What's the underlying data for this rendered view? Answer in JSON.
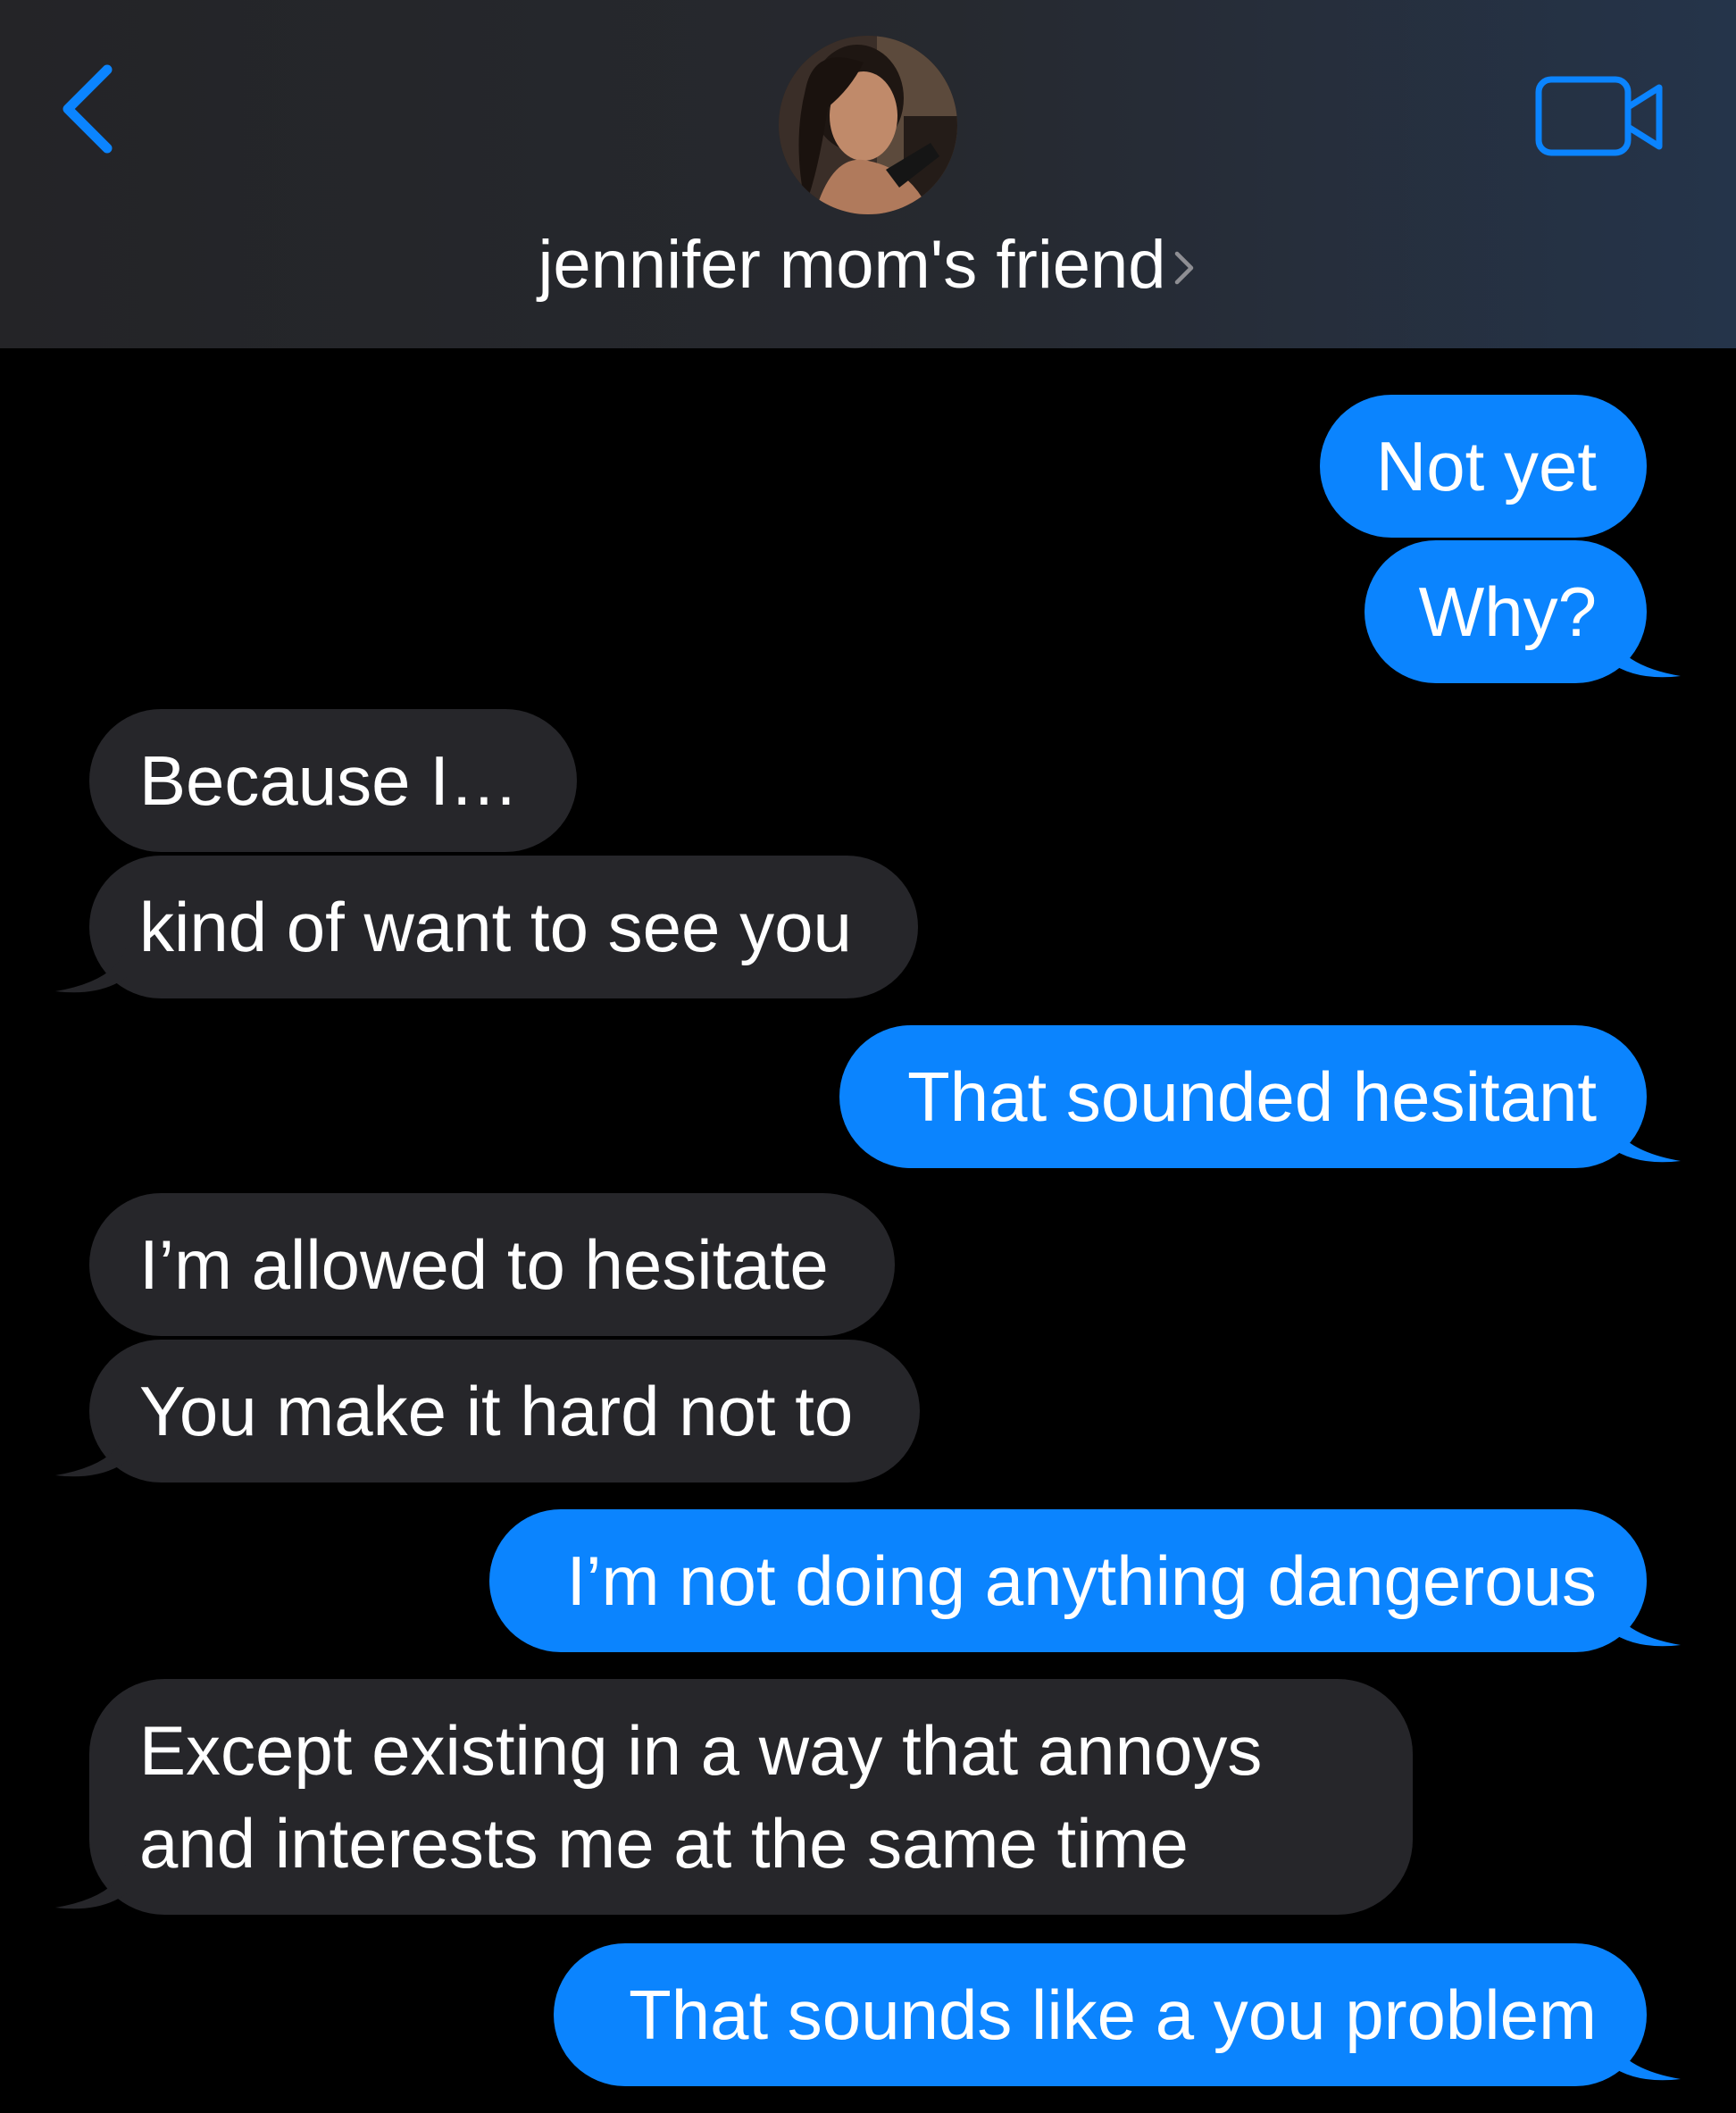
{
  "header": {
    "contact_name": "jennifer mom's friend",
    "back_icon": "chevron-left-icon",
    "video_icon": "video-camera-icon",
    "accent_color": "#0b84fe"
  },
  "messages": [
    {
      "id": "m1",
      "direction": "sent",
      "text": "Not yet",
      "tail": false
    },
    {
      "id": "m2",
      "direction": "sent",
      "text": "Why?",
      "tail": true
    },
    {
      "id": "m3",
      "direction": "received",
      "text": "Because I…",
      "tail": false
    },
    {
      "id": "m4",
      "direction": "received",
      "text": "kind of want to see you",
      "tail": true
    },
    {
      "id": "m5",
      "direction": "sent",
      "text": "That sounded hesitant",
      "tail": true
    },
    {
      "id": "m6",
      "direction": "received",
      "text": "I’m allowed to hesitate",
      "tail": false
    },
    {
      "id": "m7",
      "direction": "received",
      "text": "You make it hard not to",
      "tail": true
    },
    {
      "id": "m8",
      "direction": "sent",
      "text": "I’m not doing anything dangerous",
      "tail": true
    },
    {
      "id": "m9",
      "direction": "received",
      "text": "Except existing in a way that annoys and interests me at the same time",
      "tail": true
    },
    {
      "id": "m10",
      "direction": "sent",
      "text": "That sounds like a you problem",
      "tail": true
    }
  ],
  "colors": {
    "sent_bubble": "#0b84fe",
    "received_bubble": "#26262a",
    "background": "#000000"
  }
}
